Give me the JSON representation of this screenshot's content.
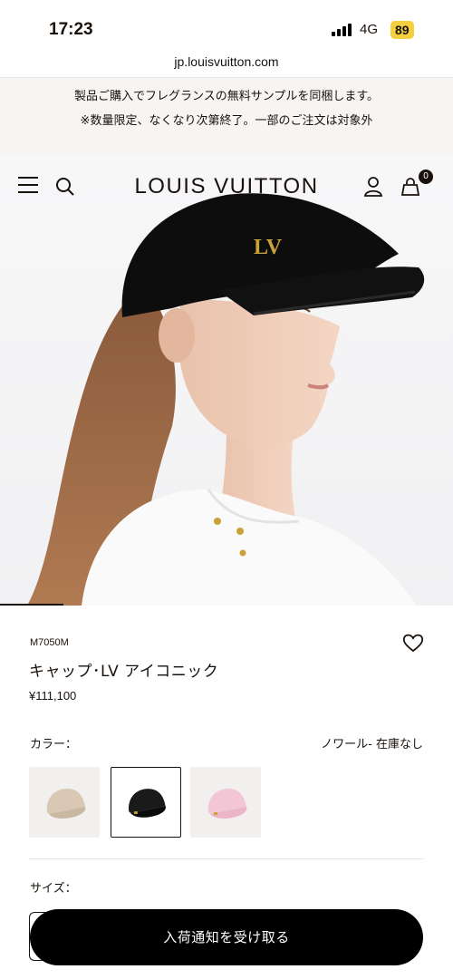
{
  "status_bar": {
    "time": "17:23",
    "network": "4G",
    "battery": "89"
  },
  "browser": {
    "url": "jp.louisvuitton.com"
  },
  "promo": {
    "line1": "製品ご購入でフレグランスの無料サンプルを同梱します。",
    "line2": "※数量限定、なくなり次第終了。一部のご注文は対象外"
  },
  "header": {
    "brand": "LOUIS VUITTON",
    "bag_count": "0"
  },
  "hero": {
    "slide_progress": 0.14
  },
  "product": {
    "sku": "M7050M",
    "name": "キャップ･LV アイコニック",
    "price": "¥111,100",
    "color_label": "カラー：",
    "color_status": "ノワール- 在庫なし",
    "color_options": [
      {
        "name": "beige",
        "color": "#d8c8b4",
        "selected": false
      },
      {
        "name": "noir",
        "color": "#1a1a1a",
        "selected": true
      },
      {
        "name": "pink",
        "color": "#f3c6d6",
        "selected": false
      }
    ],
    "size_label": "サイズ："
  },
  "cta": {
    "notify_label": "入荷通知を受け取る"
  },
  "colors": {
    "ink": "#19110b",
    "accent_gold": "#c9a23a",
    "battery": "#f4d03f"
  }
}
